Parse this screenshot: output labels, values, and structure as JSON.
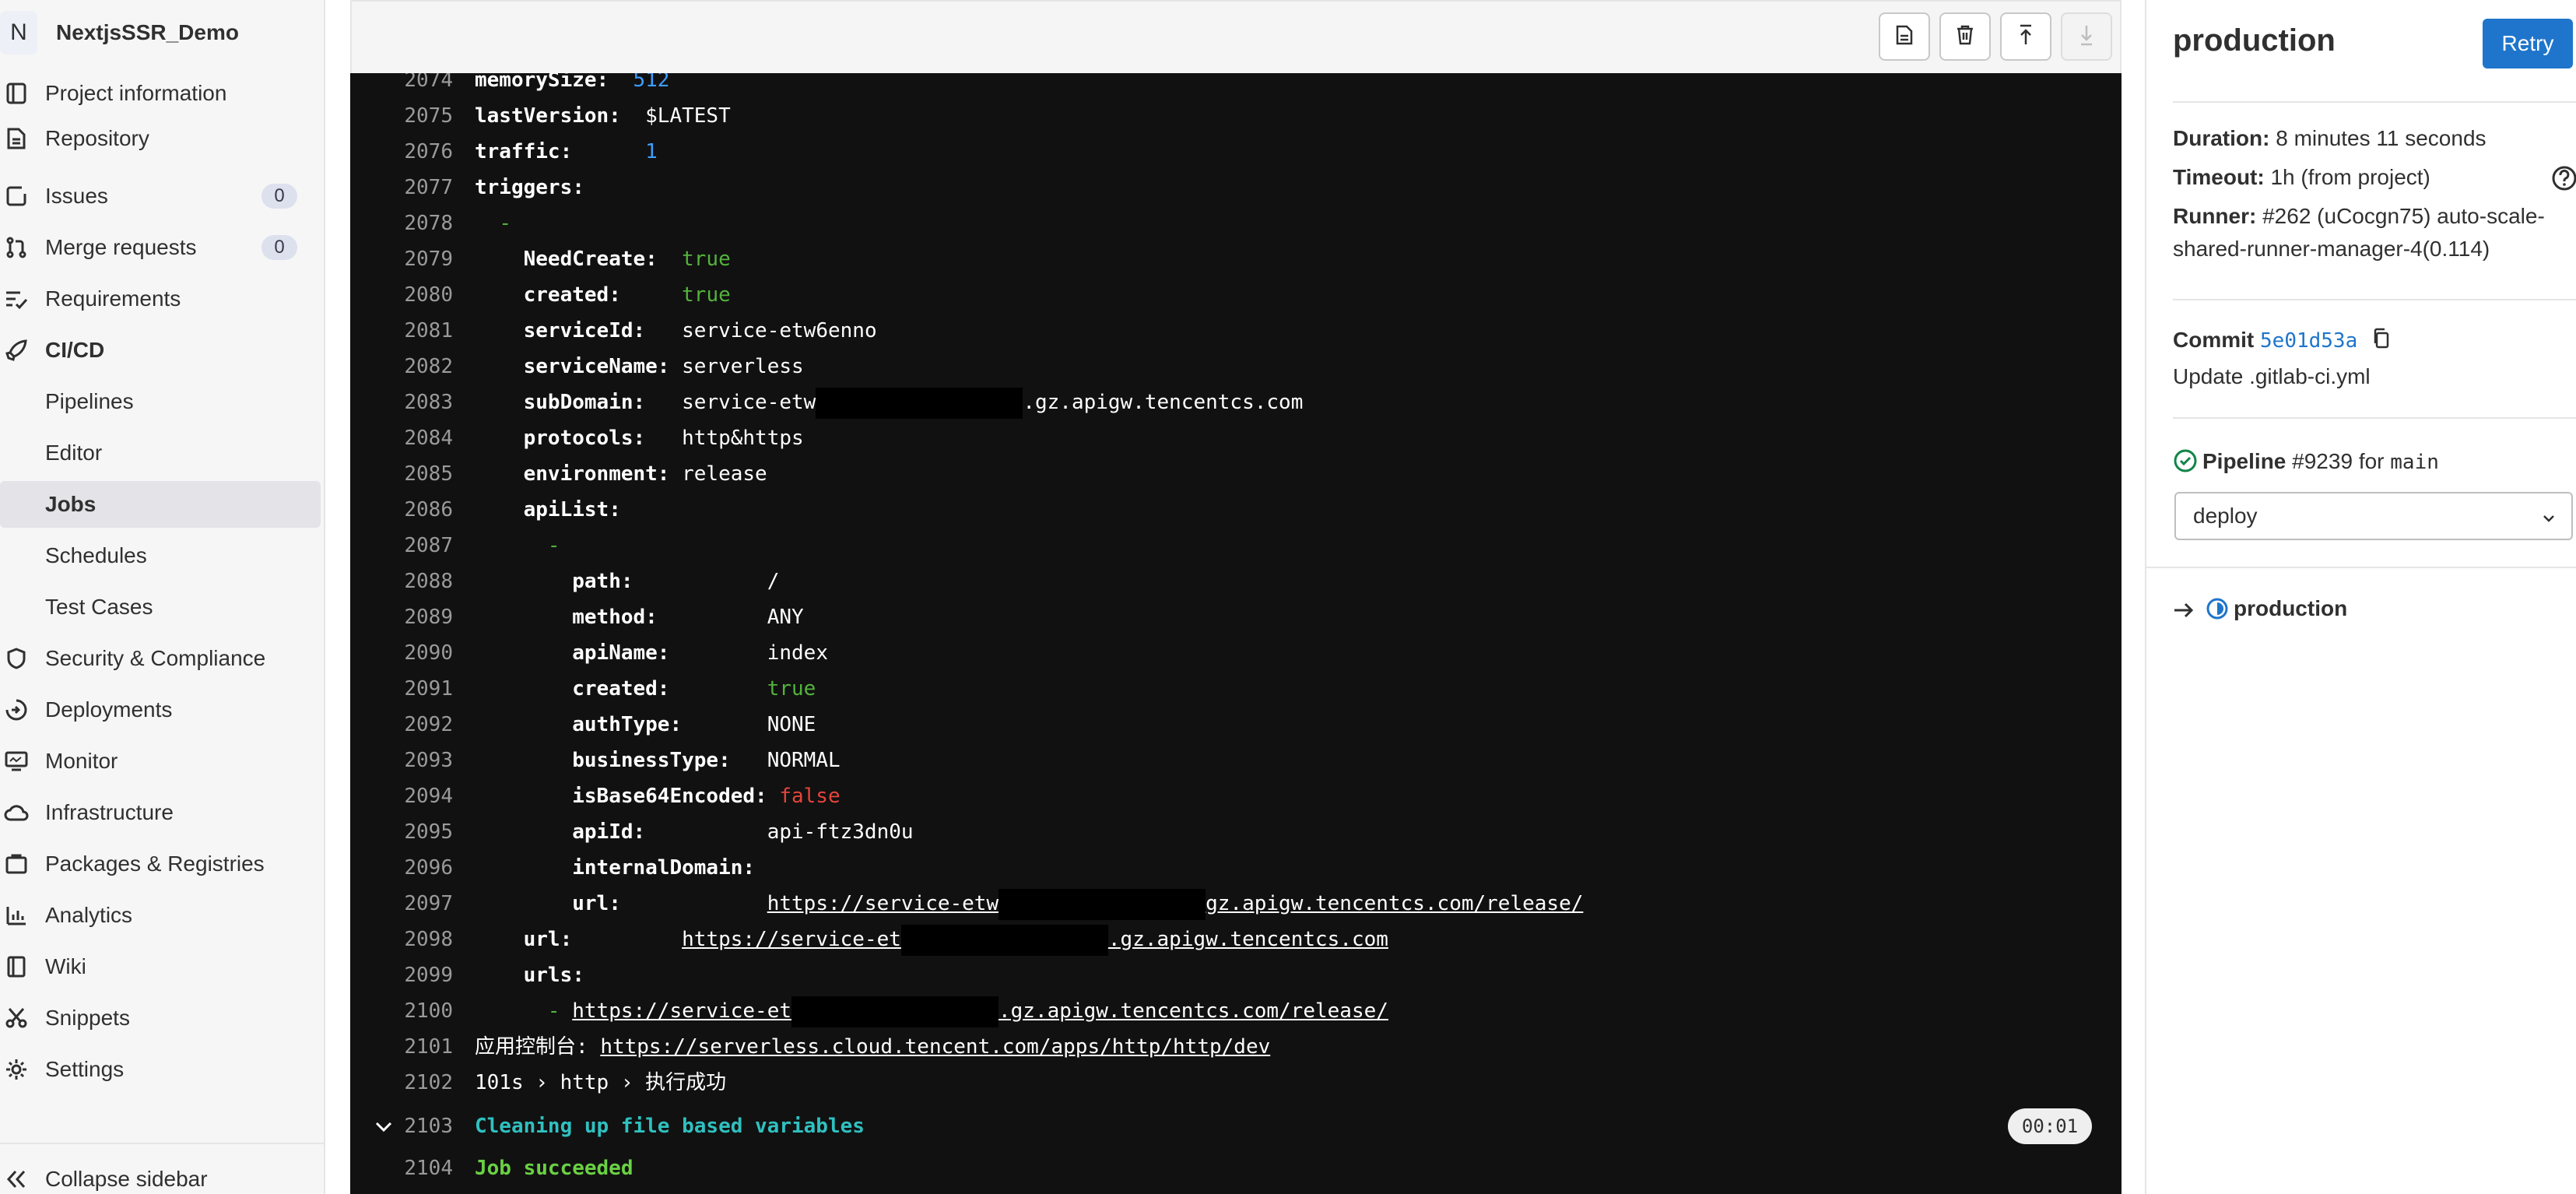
{
  "project": {
    "initial": "N",
    "name": "NextjsSSR_Demo"
  },
  "sidebar": {
    "items": [
      {
        "label": "Project information",
        "icon": "project-icon"
      },
      {
        "label": "Repository",
        "icon": "doc-icon"
      },
      {
        "label": "Issues",
        "icon": "issues-icon",
        "count": "0"
      },
      {
        "label": "Merge requests",
        "icon": "merge-icon",
        "count": "0"
      },
      {
        "label": "Requirements",
        "icon": "requirements-icon"
      },
      {
        "label": "CI/CD",
        "icon": "rocket-icon"
      },
      {
        "label": "Pipelines"
      },
      {
        "label": "Editor"
      },
      {
        "label": "Jobs"
      },
      {
        "label": "Schedules"
      },
      {
        "label": "Test Cases"
      },
      {
        "label": "Security & Compliance",
        "icon": "shield-icon"
      },
      {
        "label": "Deployments",
        "icon": "deployments-icon"
      },
      {
        "label": "Monitor",
        "icon": "monitor-icon"
      },
      {
        "label": "Infrastructure",
        "icon": "cloud-icon"
      },
      {
        "label": "Packages & Registries",
        "icon": "package-icon"
      },
      {
        "label": "Analytics",
        "icon": "chart-icon"
      },
      {
        "label": "Wiki",
        "icon": "book-icon"
      },
      {
        "label": "Snippets",
        "icon": "snippet-icon"
      },
      {
        "label": "Settings",
        "icon": "gear-icon"
      }
    ],
    "collapse_label": "Collapse sidebar"
  },
  "log": {
    "lines": [
      {
        "n": "2074",
        "key": "memorySize:",
        "val": "512"
      },
      {
        "n": "2075",
        "key": "lastVersion:",
        "val": "$LATEST"
      },
      {
        "n": "2076",
        "key": "traffic:",
        "val": "1"
      },
      {
        "n": "2077",
        "key": "triggers:"
      },
      {
        "n": "2078",
        "dash": "-"
      },
      {
        "n": "2079",
        "key": "NeedCreate:",
        "val": "true"
      },
      {
        "n": "2080",
        "key": "created:",
        "val": "true"
      },
      {
        "n": "2081",
        "key": "serviceId:",
        "val": "service-etw6enno"
      },
      {
        "n": "2082",
        "key": "serviceName:",
        "val": "serverless"
      },
      {
        "n": "2083",
        "key": "subDomain:",
        "val": "service-etw",
        "val_after": ".gz.apigw.tencentcs.com"
      },
      {
        "n": "2084",
        "key": "protocols:",
        "val": "http&https"
      },
      {
        "n": "2085",
        "key": "environment:",
        "val": "release"
      },
      {
        "n": "2086",
        "key": "apiList:"
      },
      {
        "n": "2087",
        "dash": "-"
      },
      {
        "n": "2088",
        "key": "path:",
        "val": "/"
      },
      {
        "n": "2089",
        "key": "method:",
        "val": "ANY"
      },
      {
        "n": "2090",
        "key": "apiName:",
        "val": "index"
      },
      {
        "n": "2091",
        "key": "created:",
        "val": "true"
      },
      {
        "n": "2092",
        "key": "authType:",
        "val": "NONE"
      },
      {
        "n": "2093",
        "key": "businessType:",
        "val": "NORMAL"
      },
      {
        "n": "2094",
        "key": "isBase64Encoded:",
        "val": "false"
      },
      {
        "n": "2095",
        "key": "apiId:",
        "val": "api-ftz3dn0u"
      },
      {
        "n": "2096",
        "key": "internalDomain:"
      },
      {
        "n": "2097",
        "key": "url:",
        "val": "https://service-etw",
        "val_after": "gz.apigw.tencentcs.com/release/"
      },
      {
        "n": "2098",
        "key": "url:",
        "val": "https://service-et",
        "val_after": ".gz.apigw.tencentcs.com"
      },
      {
        "n": "2099",
        "key": "urls:"
      },
      {
        "n": "2100",
        "dash": "-",
        "val": "https://service-et",
        "val_after": ".gz.apigw.tencentcs.com/release/"
      },
      {
        "n": "2101",
        "prefix": "应用控制台:",
        "val": "https://serverless.cloud.tencent.com/apps/http/http/dev"
      },
      {
        "n": "2102",
        "text": "101s › http › 执行成功"
      },
      {
        "n": "2103",
        "text": "Cleaning up file based variables"
      },
      {
        "n": "2104",
        "text": "Job succeeded"
      }
    ],
    "section_duration": "00:01"
  },
  "job": {
    "title": "production",
    "retry_label": "Retry",
    "duration_label": "Duration:",
    "duration_value": "8 minutes 11 seconds",
    "timeout_label": "Timeout:",
    "timeout_value": "1h (from project)",
    "runner_label": "Runner:",
    "runner_value_1": "#262 (uCocgn75) auto-scale-",
    "runner_value_2": "shared-runner-manager-4(0.114)",
    "commit_label": "Commit",
    "commit_sha": "5e01d53a",
    "commit_message": "Update .gitlab-ci.yml",
    "pipeline_label": "Pipeline",
    "pipeline_id": "#9239",
    "pipeline_for": "for",
    "pipeline_ref": "main",
    "stage_selected": "deploy",
    "current_job": "production"
  },
  "colors": {
    "accent": "#1f75cb",
    "log_bg": "#111111",
    "success": "#108548"
  }
}
